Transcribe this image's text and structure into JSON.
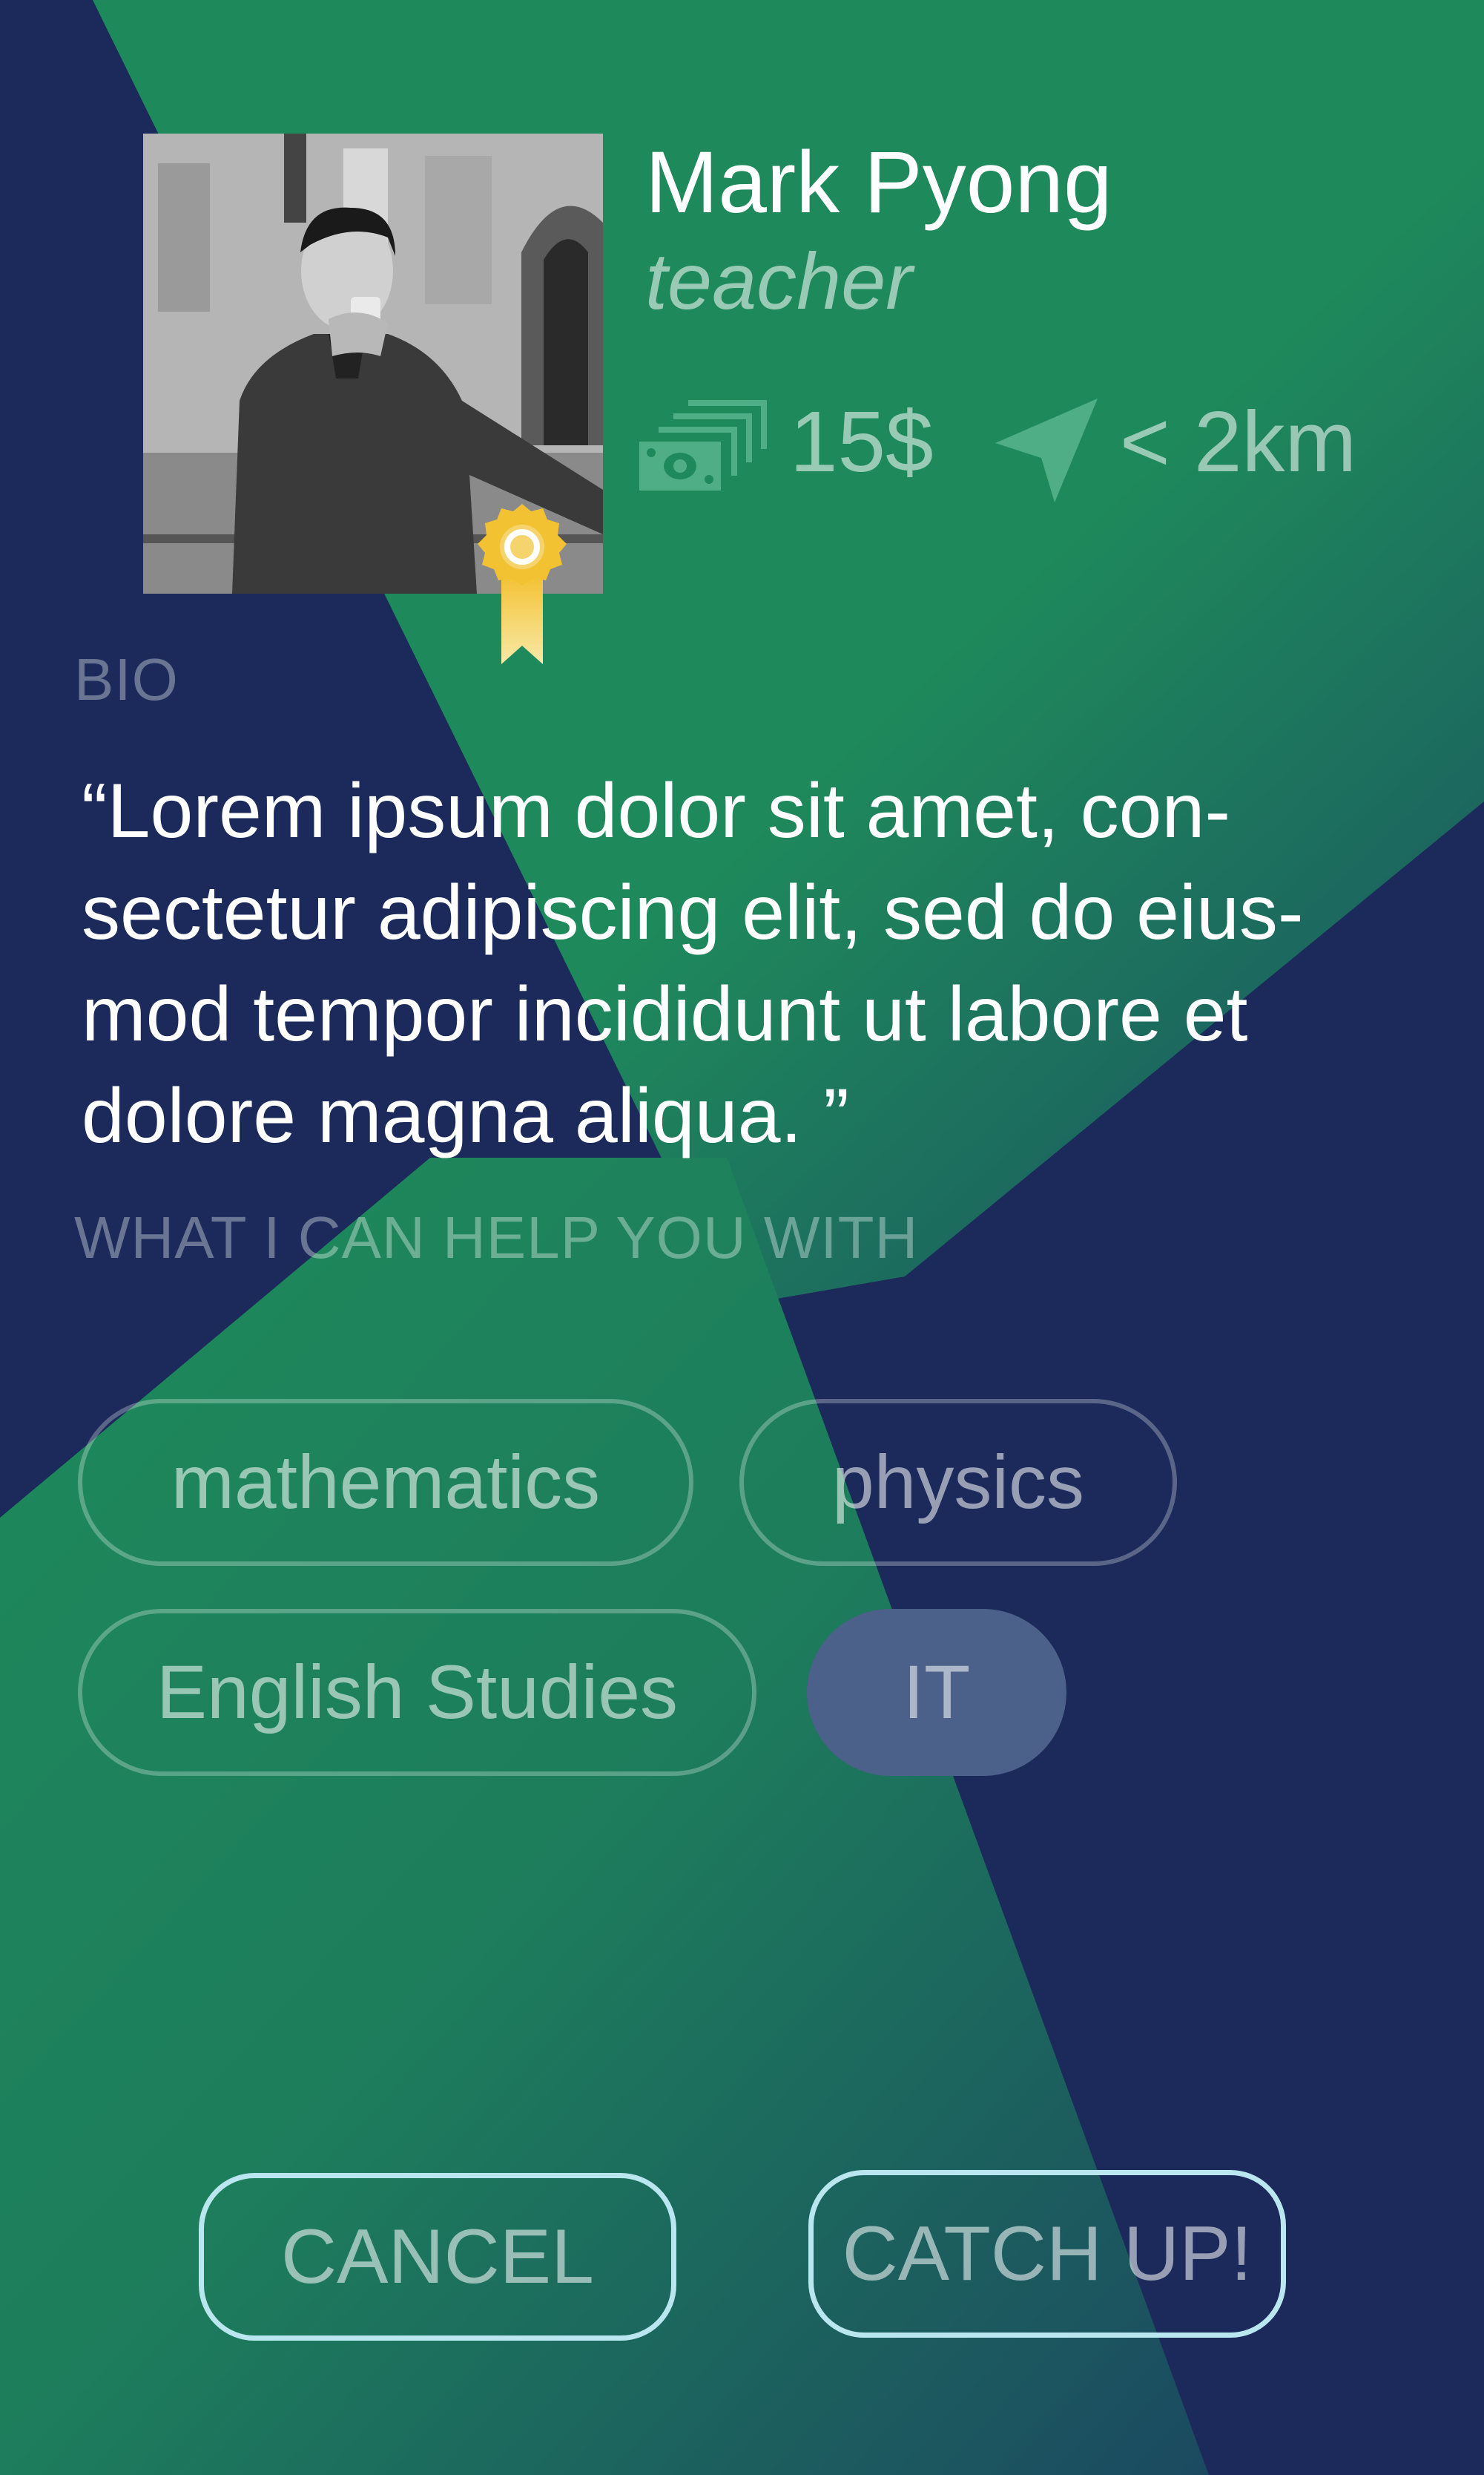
{
  "colors": {
    "navy": "#1b2a5a",
    "green": "#1e8a5b",
    "gold": "#f2c94c",
    "tag_selected": "#4b6189",
    "button_border": "#b9e6ef"
  },
  "profile": {
    "name": "Mark Pyong",
    "role": "teacher",
    "rate": "15$",
    "distance": "< 2km",
    "rate_icon": "money-stack-icon",
    "distance_icon": "navigation-arrow-icon",
    "badge_icon": "award-ribbon-icon"
  },
  "bio": {
    "title": "BIO",
    "text": "“Lorem ipsum dolor sit amet, con-\nsectetur adipiscing elit, sed do eius-\nmod tempor incididunt ut labore et\ndolore magna aliqua. ”"
  },
  "skills": {
    "title": "WHAT I CAN HELP YOU WITH",
    "tags": [
      {
        "label": "mathematics",
        "selected": false
      },
      {
        "label": "physics",
        "selected": false
      },
      {
        "label": "English Studies",
        "selected": false
      },
      {
        "label": "IT",
        "selected": true
      }
    ]
  },
  "actions": {
    "cancel": "CANCEL",
    "catch_up": "CATCH UP!"
  }
}
